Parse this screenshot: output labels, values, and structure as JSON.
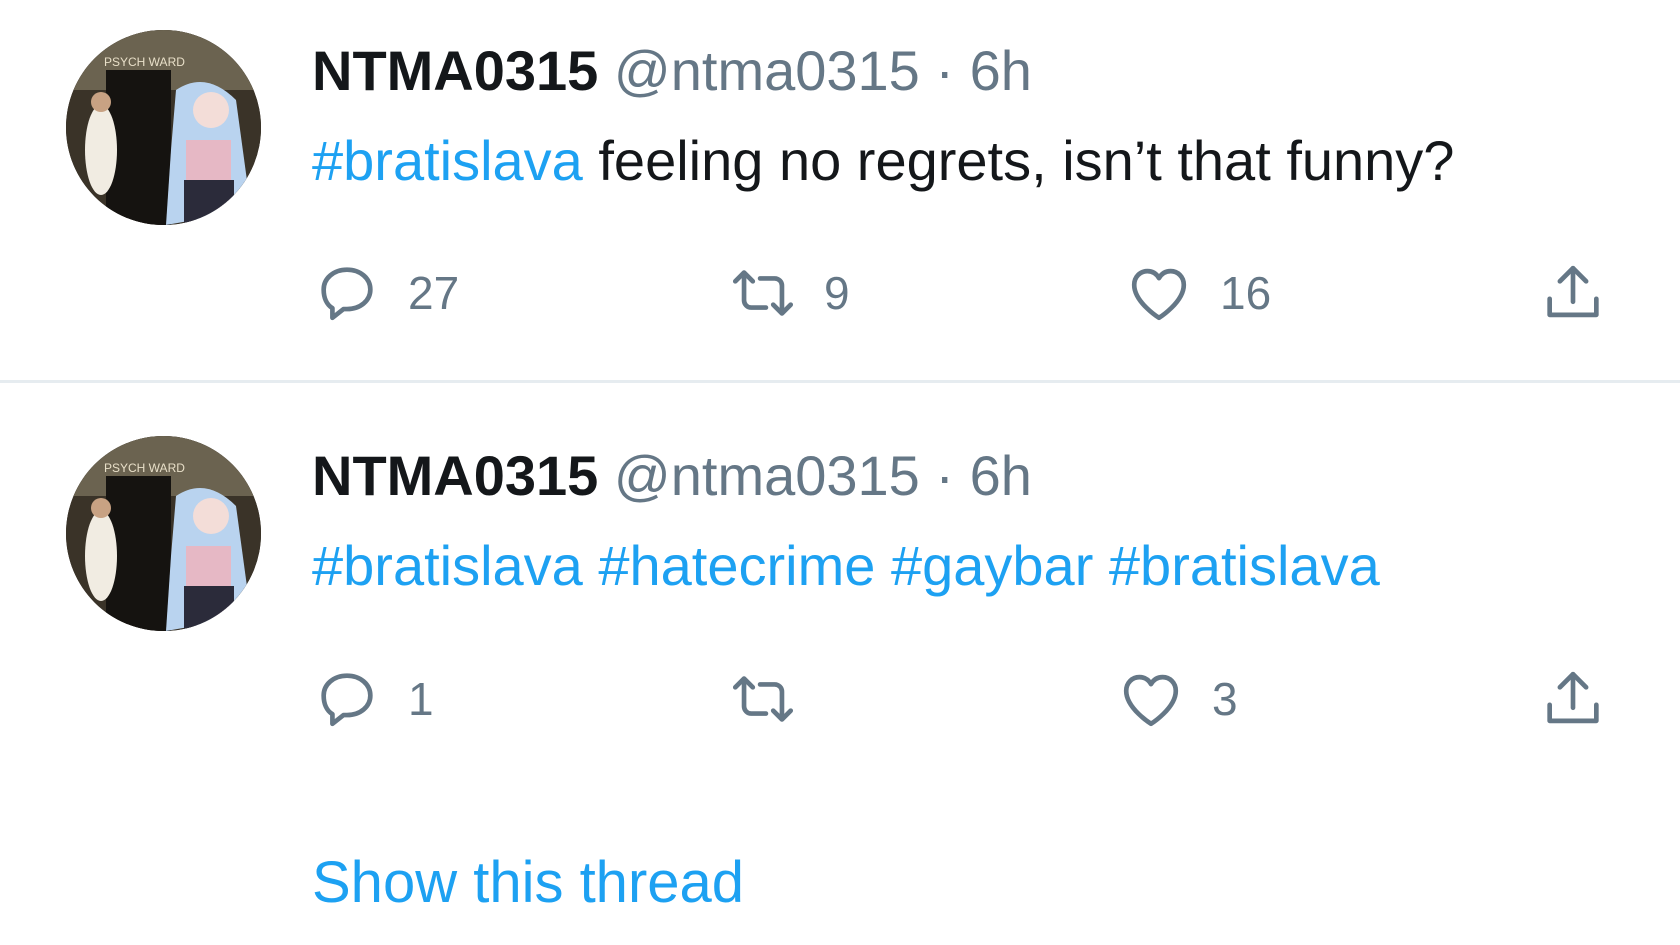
{
  "colors": {
    "link": "#1da1f2",
    "meta": "#657786",
    "text": "#14171a",
    "divider": "#e6ecf0"
  },
  "tweets": [
    {
      "name": "NTMA0315",
      "handle": "@ntma0315",
      "separator": "·",
      "time": "6h",
      "avatar": {
        "sign": "PSYCH WARD"
      },
      "body": {
        "hashtag1": "#bratislava",
        "text": " feeling no regrets, isn’t that funny?"
      },
      "actions": {
        "reply_count": "27",
        "retweet_count": "9",
        "like_count": "16"
      }
    },
    {
      "name": "NTMA0315",
      "handle": "@ntma0315",
      "separator": "·",
      "time": "6h",
      "avatar": {
        "sign": "PSYCH WARD"
      },
      "body": {
        "hashtags": [
          "#bratislava",
          "#hatecrime",
          "#gaybar",
          "#bratislava"
        ]
      },
      "actions": {
        "reply_count": "1",
        "retweet_count": "",
        "like_count": "3"
      }
    }
  ],
  "show_thread": "Show this thread",
  "icons": [
    "reply-icon",
    "retweet-icon",
    "like-icon",
    "share-icon"
  ]
}
